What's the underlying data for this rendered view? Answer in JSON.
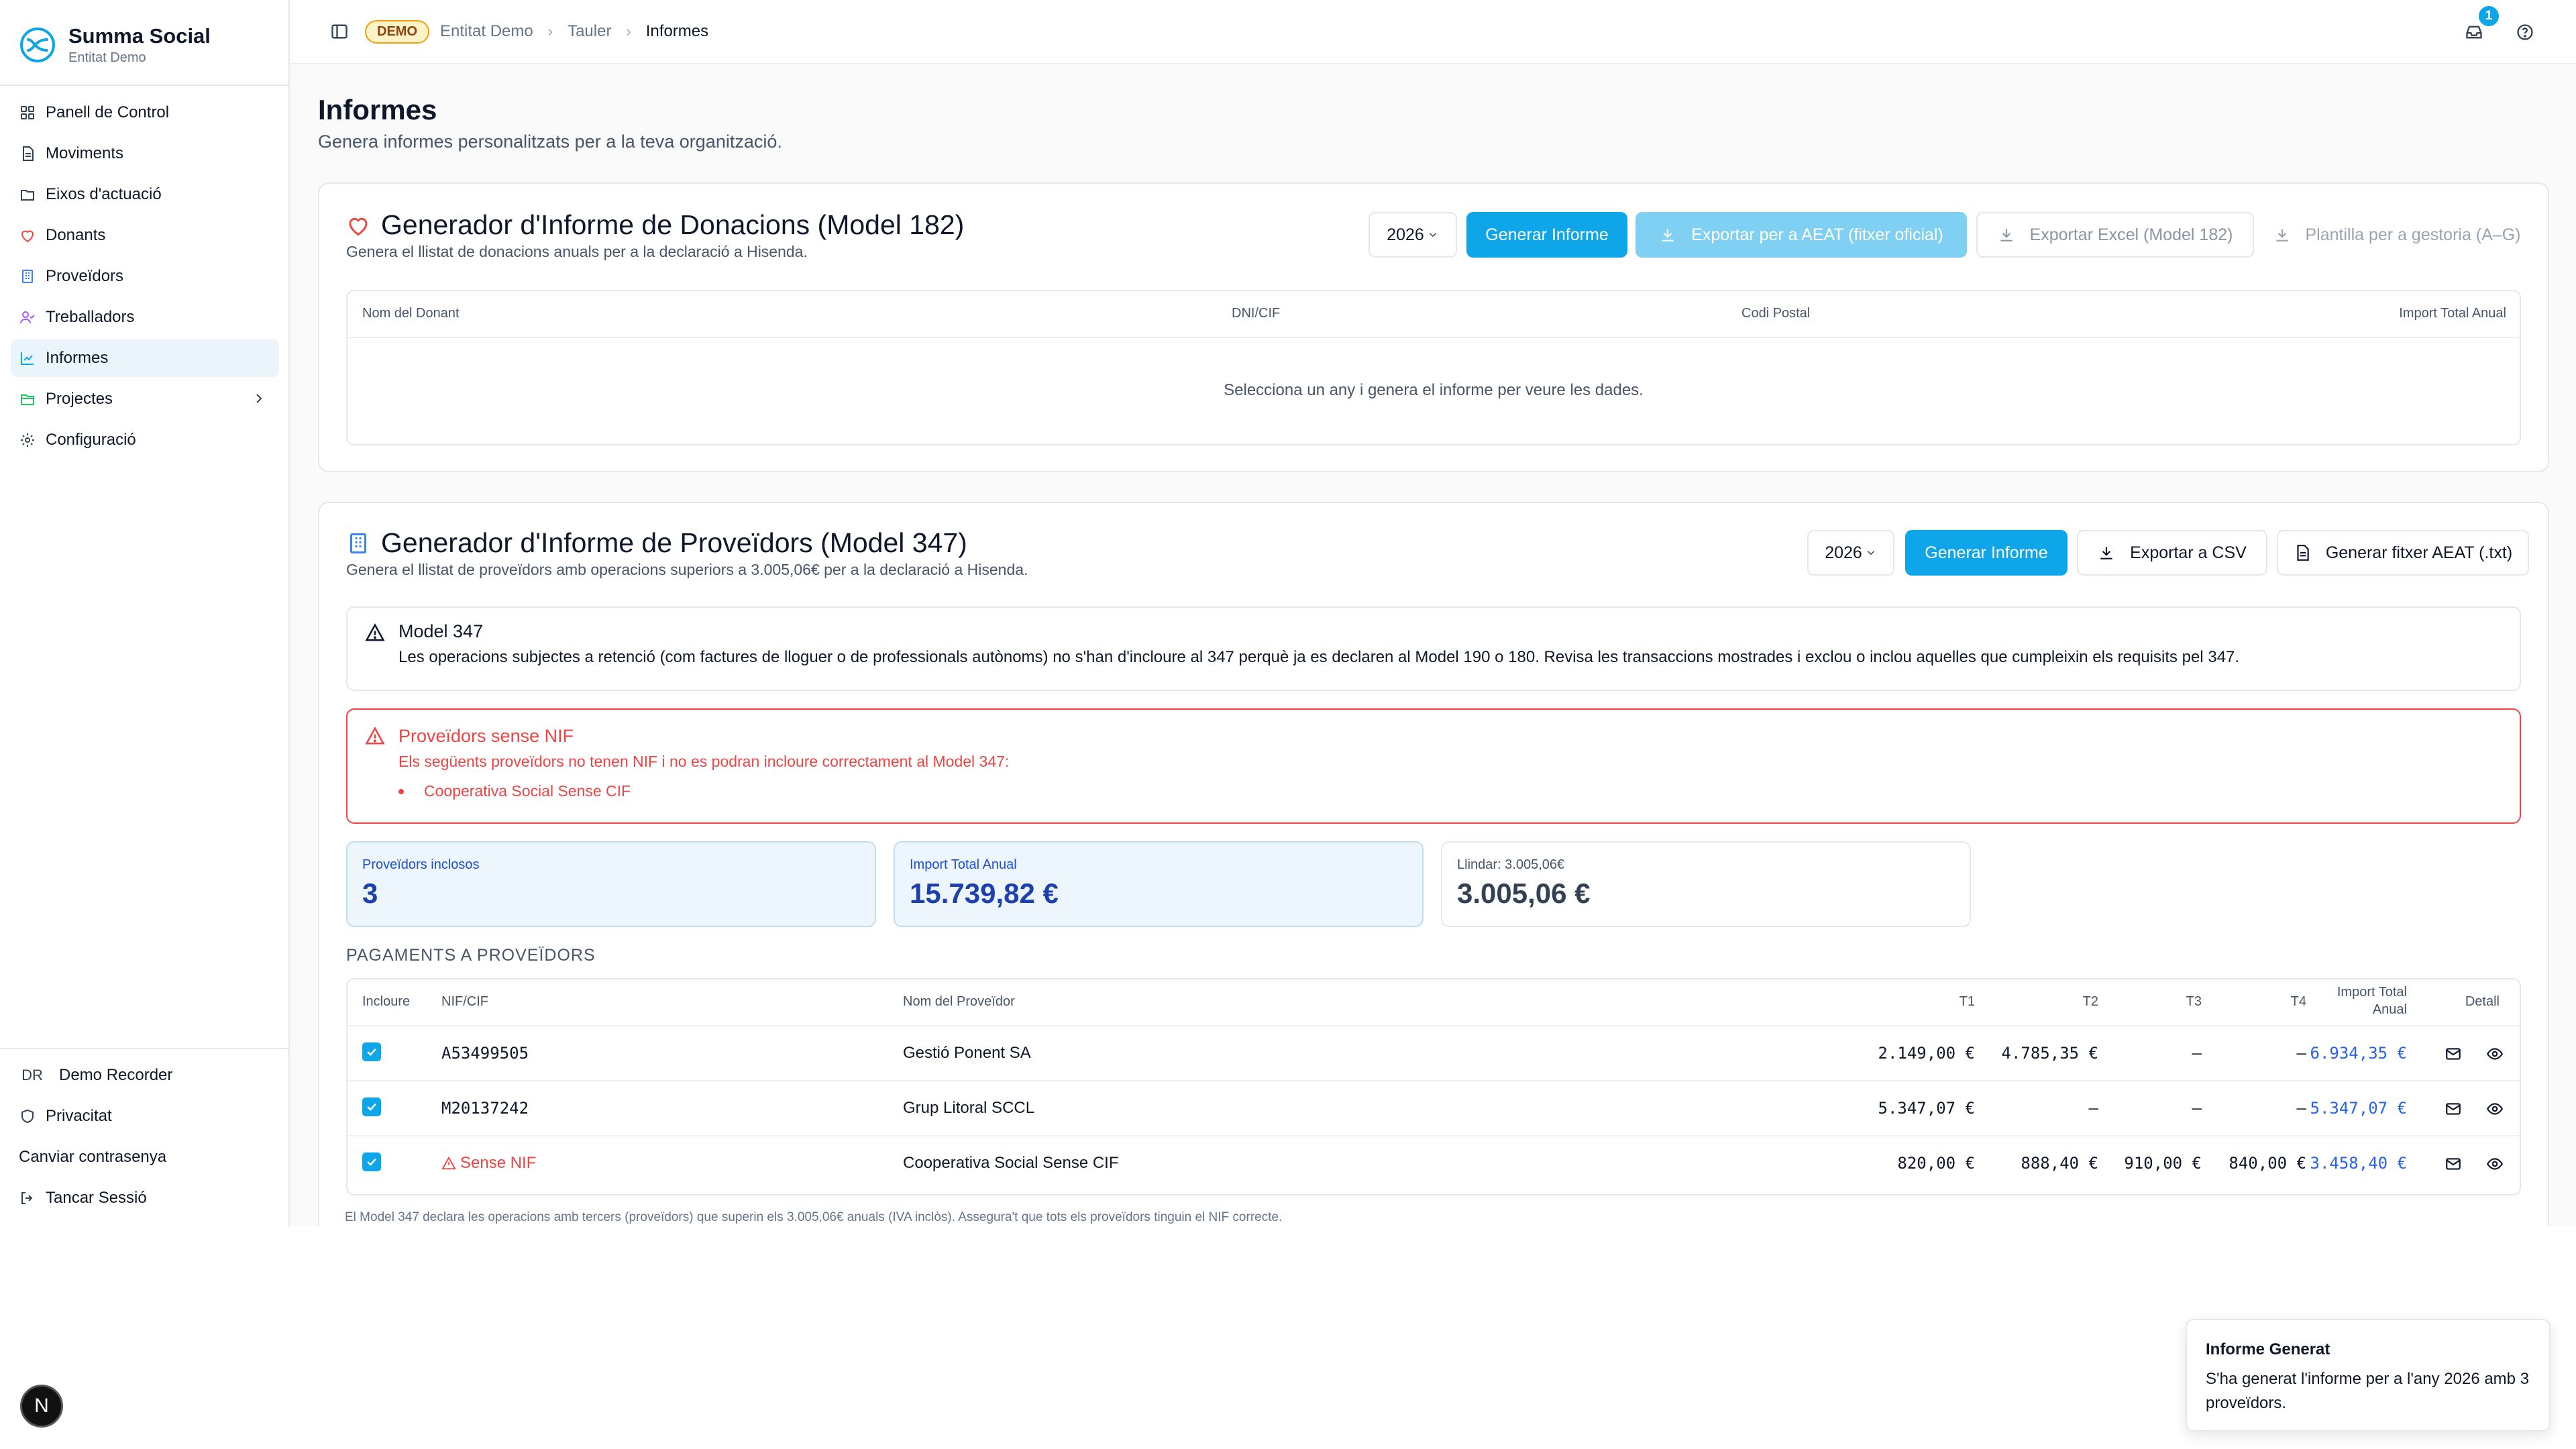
{
  "app": {
    "name": "Summa Social",
    "org": "Entitat Demo"
  },
  "sidebar": {
    "items": [
      {
        "label": "Panell de Control",
        "icon": "dashboard-icon"
      },
      {
        "label": "Moviments",
        "icon": "document-icon"
      },
      {
        "label": "Eixos d'actuació",
        "icon": "folder-icon"
      },
      {
        "label": "Donants",
        "icon": "heart-icon"
      },
      {
        "label": "Proveïdors",
        "icon": "building-icon"
      },
      {
        "label": "Treballadors",
        "icon": "users-icon"
      },
      {
        "label": "Informes",
        "icon": "chart-icon"
      },
      {
        "label": "Projectes",
        "icon": "folder-open-icon"
      },
      {
        "label": "Configuració",
        "icon": "gear-icon"
      }
    ],
    "active": "Informes",
    "user": {
      "initials": "DR",
      "name": "Demo Recorder"
    },
    "bottom": {
      "privacy": "Privacitat",
      "change_password": "Canviar contrasenya",
      "logout": "Tancar Sessió"
    }
  },
  "topbar": {
    "badge": "DEMO",
    "breadcrumb": [
      "Entitat Demo",
      "Tauler",
      "Informes"
    ],
    "notifications_count": "1"
  },
  "page": {
    "title": "Informes",
    "subtitle": "Genera informes personalitzats per a la teva organització."
  },
  "model182": {
    "title": "Generador d'Informe de Donacions (Model 182)",
    "subtitle": "Genera el llistat de donacions anuals per a la declaració a Hisenda.",
    "year": "2026",
    "generate": "Generar Informe",
    "export_aeat": "Exportar per a AEAT (fitxer oficial)",
    "export_excel": "Exportar Excel (Model 182)",
    "template": "Plantilla per a gestoria (A–G)",
    "columns": [
      "Nom del Donant",
      "DNI/CIF",
      "Codi Postal",
      "Import Total Anual"
    ],
    "empty": "Selecciona un any i genera el informe per veure les dades."
  },
  "model347": {
    "title": "Generador d'Informe de Proveïdors (Model 347)",
    "subtitle": "Genera el llistat de proveïdors amb operacions superiors a 3.005,06€ per a la declaració a Hisenda.",
    "year": "2026",
    "generate": "Generar Informe",
    "export_csv": "Exportar a CSV",
    "export_aeat": "Generar fitxer AEAT (.txt)",
    "info_title": "Model 347",
    "info_text": "Les operacions subjectes a retenció (com factures de lloguer o de professionals autònoms) no s'han d'incloure al 347 perquè ja es declaren al Model 190 o 180. Revisa les transaccions mostrades i exclou o inclou aquelles que cumpleixin els requisits pel 347.",
    "warn_title": "Proveïdors sense NIF",
    "warn_text": "Els següents proveïdors no tenen NIF i no es podran incloure correctament al Model 347:",
    "warn_items": [
      "Cooperativa Social Sense CIF"
    ],
    "stats": [
      {
        "label": "Proveïdors inclosos",
        "value": "3"
      },
      {
        "label": "Import Total Anual",
        "value": "15.739,82 €"
      },
      {
        "label": "Llindar: 3.005,06€",
        "value": "3.005,06 €"
      }
    ],
    "payments_title": "PAGAMENTS A PROVEÏDORS",
    "columns": {
      "include": "Incloure",
      "nif": "NIF/CIF",
      "name": "Nom del Proveïdor",
      "t1": "T1",
      "t2": "T2",
      "t3": "T3",
      "t4": "T4",
      "total_l1": "Import Total",
      "total_l2": "Anual",
      "detail": "Detall"
    },
    "rows": [
      {
        "nif": "A53499505",
        "name": "Gestió Ponent SA",
        "t1": "2.149,00 €",
        "t2": "4.785,35 €",
        "t3": "—",
        "t4": "—",
        "total": "6.934,35 €",
        "included": true,
        "missing_nif": false
      },
      {
        "nif": "M20137242",
        "name": "Grup Litoral SCCL",
        "t1": "5.347,07 €",
        "t2": "—",
        "t3": "—",
        "t4": "—",
        "total": "5.347,07 €",
        "included": true,
        "missing_nif": false
      },
      {
        "nif": "Sense NIF",
        "name": "Cooperativa Social Sense CIF",
        "t1": "820,00 €",
        "t2": "888,40 €",
        "t3": "910,00 €",
        "t4": "840,00 €",
        "total": "3.458,40 €",
        "included": true,
        "missing_nif": true
      }
    ],
    "footer": "El Model 347 declara les operacions amb tercers (proveïdors) que superin els 3.005,06€ anuals (IVA inclòs). Assegura't que tots els proveïdors tinguin el NIF correcte."
  },
  "toast": {
    "title": "Informe Generat",
    "text": "S'ha generat l'informe per a l'any 2026 amb 3 proveïdors."
  },
  "dev_badge": "N",
  "colors": {
    "primary": "#0ea5e9",
    "primary_disabled": "#7fd0f3",
    "danger": "#ef4444",
    "link_blue": "#2563eb",
    "active_nav": "#eaf4fb"
  }
}
